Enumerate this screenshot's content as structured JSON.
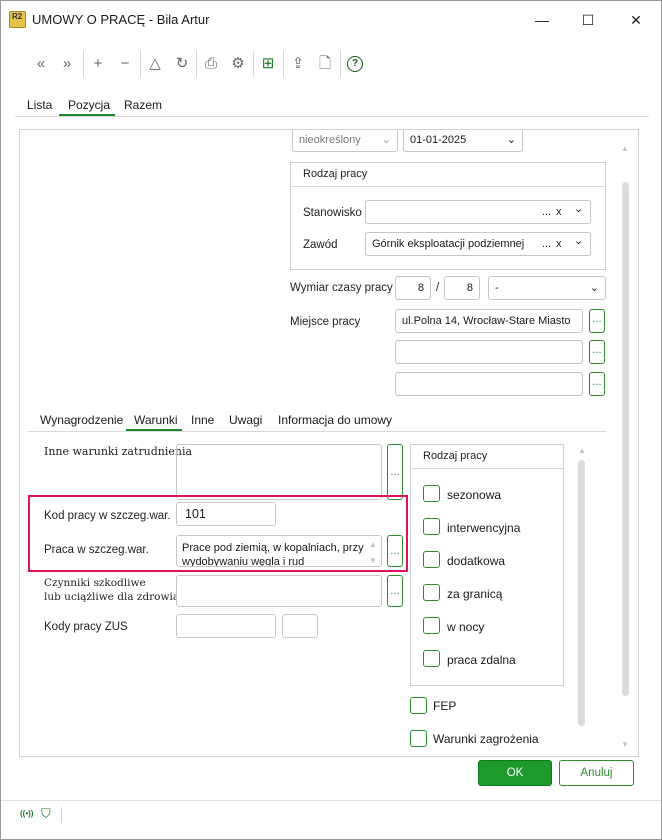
{
  "window": {
    "title": "UMOWY O PRACĘ - Bila Artur",
    "app_icon": "R2",
    "minimize": "—",
    "maximize": "☐",
    "close": "✕"
  },
  "toolbar": {
    "first": "«",
    "last": "»",
    "add": "+",
    "remove": "−",
    "warning": "△",
    "refresh": "↻",
    "print": "⎙",
    "settings": "⚙",
    "split": "⊞",
    "export": "⇪",
    "document": "🗋",
    "help": "?"
  },
  "main_tabs": [
    "Lista",
    "Pozycja",
    "Razem"
  ],
  "top_partial": {
    "select_left": "nieokreślony",
    "date": "01-01-2025"
  },
  "rodzaj_pracy_group": {
    "title": "Rodzaj pracy",
    "stanowisko_label": "Stanowisko",
    "stanowisko_value": "",
    "zawod_label": "Zawód",
    "zawod_value": "Górnik eksploatacji podziemnej",
    "dots": "...",
    "clear": "x",
    "chevron": "⌄"
  },
  "wymiar": {
    "label": "Wymiar czasy pracy",
    "num": "8",
    "sep": "/",
    "den": "8",
    "select": "-"
  },
  "miejsce": {
    "label": "Miejsce pracy",
    "line1": "ul.Polna 14,  Wrocław-Stare Miasto",
    "line2": "",
    "line3": "",
    "dots": "..."
  },
  "sub_tabs": [
    "Wynagrodzenie",
    "Warunki",
    "Inne",
    "Uwagi",
    "Informacja do umowy"
  ],
  "warunki": {
    "inne_label": "Inne warunki zatrudnienia",
    "inne_value": "",
    "kod_label": "Kod pracy w szczeg.war.",
    "kod_value": "101",
    "praca_label": "Praca w szczeg.war.",
    "praca_value_line1": "Prace pod ziemią, w kopalniach, przy",
    "praca_value_line2": "wydobywaniu węgla i rud",
    "czynniki_label_line1": "Czynniki szkodliwe",
    "czynniki_label_line2": "lub uciążliwe dla zdrowia",
    "czynniki_value": "",
    "zus_label": "Kody pracy ZUS",
    "zus_value": "",
    "zus_value2": "",
    "dots": "..."
  },
  "rodzaj_checkboxes": {
    "title": "Rodzaj pracy",
    "items": [
      "sezonowa",
      "interwencyjna",
      "dodatkowa",
      "za granicą",
      "w nocy",
      "praca zdalna"
    ]
  },
  "extra_checkboxes": [
    "FEP",
    "Warunki zagrożenia"
  ],
  "buttons": {
    "ok": "OK",
    "cancel": "Anuluj"
  },
  "status": {
    "signal": "((•))",
    "filter": "⛉"
  },
  "colors": {
    "accent": "#1e9a2c",
    "highlight": "#e0125c"
  }
}
